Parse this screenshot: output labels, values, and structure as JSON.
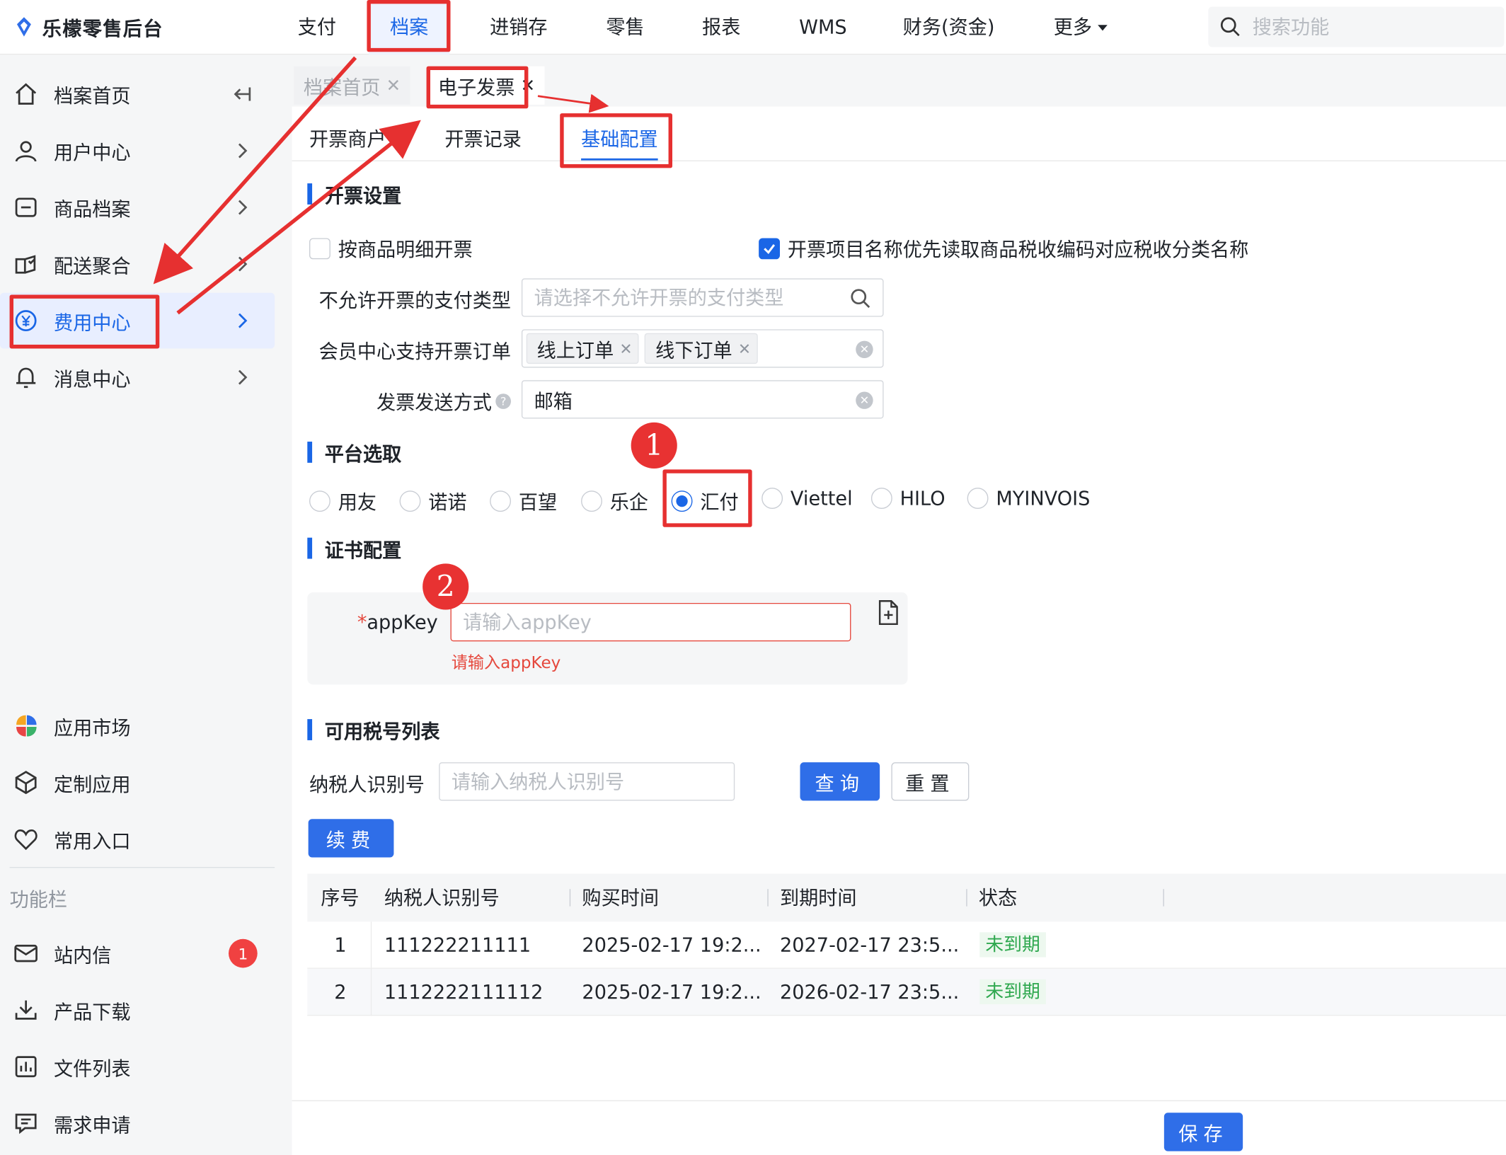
{
  "app": {
    "title": "乐檬零售后台"
  },
  "topnav": [
    {
      "label": "支付"
    },
    {
      "label": "档案"
    },
    {
      "label": "进销存"
    },
    {
      "label": "零售"
    },
    {
      "label": "报表"
    },
    {
      "label": "WMS"
    },
    {
      "label": "财务(资金)"
    },
    {
      "label": "更多"
    }
  ],
  "search": {
    "placeholder": "搜索功能"
  },
  "sidebar": {
    "items": [
      {
        "label": "档案首页"
      },
      {
        "label": "用户中心"
      },
      {
        "label": "商品档案"
      },
      {
        "label": "配送聚合"
      },
      {
        "label": "费用中心"
      },
      {
        "label": "消息中心"
      }
    ],
    "bottom_items": [
      {
        "label": "应用市场"
      },
      {
        "label": "定制应用"
      },
      {
        "label": "常用入口"
      }
    ],
    "section_label": "功能栏",
    "func_items": [
      {
        "label": "站内信",
        "badge": "1"
      },
      {
        "label": "产品下载"
      },
      {
        "label": "文件列表"
      },
      {
        "label": "需求申请"
      }
    ]
  },
  "page_tabs": [
    {
      "label": "档案首页"
    },
    {
      "label": "电子发票"
    }
  ],
  "sub_tabs": [
    {
      "label": "开票商户"
    },
    {
      "label": "开票记录"
    },
    {
      "label": "基础配置"
    }
  ],
  "invoice_settings": {
    "title": "开票设置",
    "by_detail": {
      "label": "按商品明细开票",
      "checked": false
    },
    "prefer_tax_name": {
      "label": "开票项目名称优先读取商品税收编码对应税收分类名称",
      "checked": true
    },
    "disallowed_pay": {
      "label": "不允许开票的支付类型",
      "placeholder": "请选择不允许开票的支付类型"
    },
    "member_orders": {
      "label": "会员中心支持开票订单",
      "tags": [
        "线上订单",
        "线下订单"
      ]
    },
    "send_method": {
      "label": "发票发送方式",
      "value": "邮箱"
    }
  },
  "platform": {
    "title": "平台选取",
    "options": [
      "用友",
      "诺诺",
      "百望",
      "乐企",
      "汇付",
      "Viettel",
      "HILO",
      "MYINVOIS"
    ],
    "selected": "汇付"
  },
  "cert": {
    "title": "证书配置",
    "required_mark": "*",
    "appkey_label": "appKey",
    "appkey_placeholder": "请输入appKey",
    "appkey_error": "请输入appKey"
  },
  "tax_list": {
    "title": "可用税号列表",
    "filter_label": "纳税人识别号",
    "filter_placeholder": "请输入纳税人识别号",
    "query_button": "查询",
    "reset_button": "重置",
    "renew_button": "续费",
    "columns": [
      "序号",
      "纳税人识别号",
      "购买时间",
      "到期时间",
      "状态"
    ],
    "rows": [
      {
        "no": "1",
        "tax_id": "111222211111",
        "buy_time": "2025-02-17 19:2...",
        "expire_time": "2027-02-17 23:5...",
        "status": "未到期"
      },
      {
        "no": "2",
        "tax_id": "1112222111112",
        "buy_time": "2025-02-17 19:2...",
        "expire_time": "2026-02-17 23:5...",
        "status": "未到期"
      }
    ]
  },
  "footer": {
    "save_button": "保存"
  },
  "annotations": {
    "step1": "1",
    "step2": "2"
  },
  "colors": {
    "accent": "#1a66e6",
    "annotation": "#e63030",
    "status_ok": "#2fa84f",
    "error": "#e5483d"
  }
}
